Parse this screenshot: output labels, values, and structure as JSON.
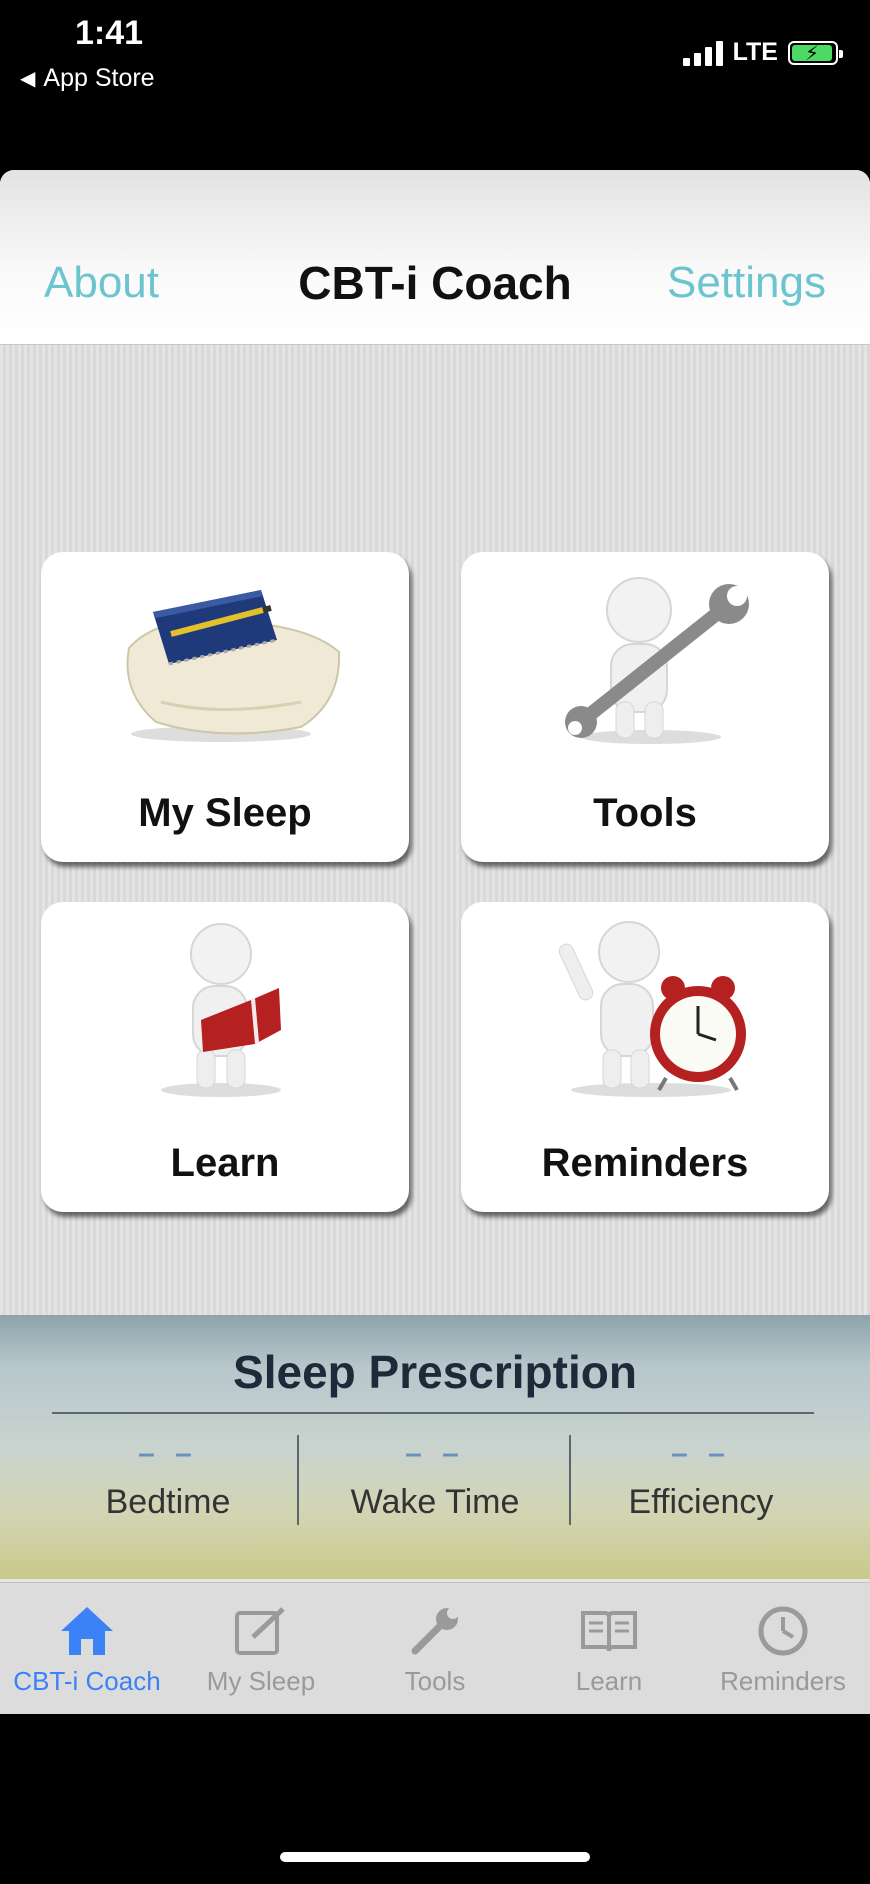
{
  "status_bar": {
    "time": "1:41",
    "back_label": "App Store",
    "network": "LTE",
    "battery_color": "#4cd964"
  },
  "nav": {
    "title": "CBT-i Coach",
    "left_button": "About",
    "right_button": "Settings",
    "accent_color": "#6cc4cf"
  },
  "tiles": [
    {
      "label": "My Sleep",
      "icon": "notebook-on-pillow-icon"
    },
    {
      "label": "Tools",
      "icon": "figure-with-wrench-icon"
    },
    {
      "label": "Learn",
      "icon": "figure-reading-book-icon"
    },
    {
      "label": "Reminders",
      "icon": "figure-with-alarm-clock-icon"
    }
  ],
  "sleep_prescription": {
    "title": "Sleep Prescription",
    "bedtime_value": "– –",
    "bedtime_label": "Bedtime",
    "waketime_value": "– –",
    "waketime_label": "Wake Time",
    "efficiency_value": "– –",
    "efficiency_label": "Efficiency"
  },
  "tab_bar": {
    "active_color": "#3b82f6",
    "items": [
      {
        "label": "CBT-i Coach",
        "icon": "home-icon",
        "active": true
      },
      {
        "label": "My Sleep",
        "icon": "edit-icon",
        "active": false
      },
      {
        "label": "Tools",
        "icon": "wrench-icon",
        "active": false
      },
      {
        "label": "Learn",
        "icon": "book-icon",
        "active": false
      },
      {
        "label": "Reminders",
        "icon": "clock-icon",
        "active": false
      }
    ]
  }
}
